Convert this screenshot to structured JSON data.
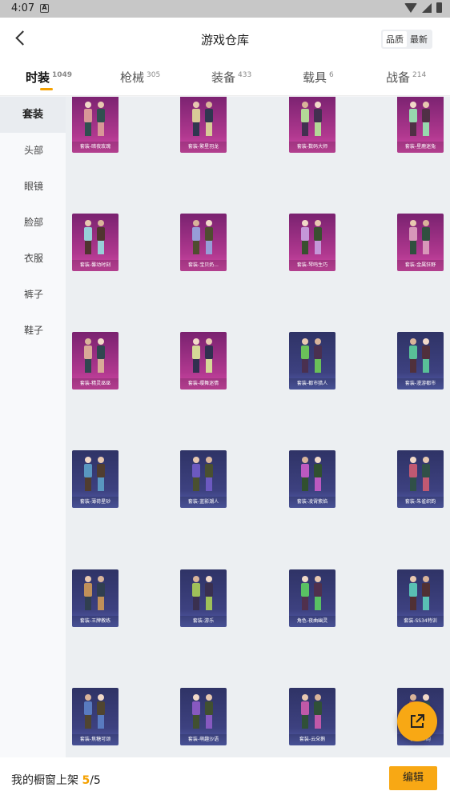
{
  "status_bar": {
    "time": "4:07",
    "a_icon": "A"
  },
  "header": {
    "title": "游戏仓库",
    "sort": [
      "品质",
      "最新"
    ]
  },
  "tabs": [
    {
      "label": "时装",
      "count": "1049"
    },
    {
      "label": "枪械",
      "count": "305"
    },
    {
      "label": "装备",
      "count": "433"
    },
    {
      "label": "载具",
      "count": "6"
    },
    {
      "label": "战备",
      "count": "214"
    }
  ],
  "sidebar": [
    "套装",
    "头部",
    "眼镜",
    "脸部",
    "衣服",
    "裤子",
    "鞋子"
  ],
  "items": [
    {
      "name": "套装-暗夜玫瑰",
      "rarity": "pink"
    },
    {
      "name": "套装-繁星羽龙",
      "rarity": "pink"
    },
    {
      "name": "套装-数码大师",
      "rarity": "pink"
    },
    {
      "name": "套装-星鹿迷兔",
      "rarity": "pink"
    },
    {
      "name": "套装-馨动时刻",
      "rarity": "pink"
    },
    {
      "name": "套装-宝贝奶...",
      "rarity": "pink"
    },
    {
      "name": "套装-琴鸣生巧",
      "rarity": "pink"
    },
    {
      "name": "套装-金属狂野",
      "rarity": "pink"
    },
    {
      "name": "套装-精灵巫巫",
      "rarity": "pink"
    },
    {
      "name": "套装-缨舞迷情",
      "rarity": "pink"
    },
    {
      "name": "套装-都市猎人",
      "rarity": "blue"
    },
    {
      "name": "套装-漫游都市",
      "rarity": "blue"
    },
    {
      "name": "套装-薄荷星砂",
      "rarity": "blue"
    },
    {
      "name": "套装-蓝影潮人",
      "rarity": "blue"
    },
    {
      "name": "套装-凌霄紫焰",
      "rarity": "blue"
    },
    {
      "name": "套装-朱雀织韵",
      "rarity": "blue"
    },
    {
      "name": "套装-王牌教练",
      "rarity": "blue"
    },
    {
      "name": "套装-游乐",
      "rarity": "blue"
    },
    {
      "name": "角色-夜曲幽灵",
      "rarity": "blue"
    },
    {
      "name": "套装-SS34特训",
      "rarity": "blue"
    },
    {
      "name": "套装-焦糖可颂",
      "rarity": "blue"
    },
    {
      "name": "套装-萌趣沙语",
      "rarity": "blue"
    },
    {
      "name": "套装-云朵鹅",
      "rarity": "blue"
    },
    {
      "name": "套装-...韵",
      "rarity": "blue"
    }
  ],
  "footer": {
    "label": "我的橱窗上架",
    "current": "5",
    "sep": "/",
    "total": "5",
    "edit": "编辑"
  },
  "colors": {
    "accent": "#f8a814",
    "pink": "#b0388f",
    "blue": "#3d4180"
  },
  "icons": {
    "back": "chevron-left-icon",
    "share": "share-icon"
  }
}
